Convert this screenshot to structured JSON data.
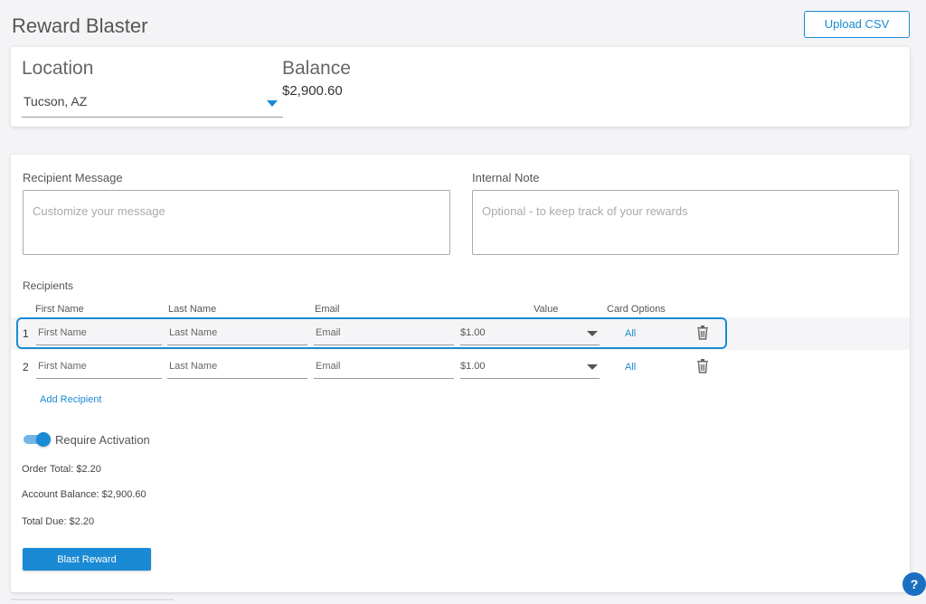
{
  "page": {
    "title": "Reward Blaster",
    "upload_label": "Upload CSV"
  },
  "location": {
    "label": "Location",
    "value": "Tucson, AZ"
  },
  "balance": {
    "label": "Balance",
    "value": "$2,900.60"
  },
  "recipient_message": {
    "label": "Recipient Message",
    "placeholder": "Customize your message"
  },
  "internal_note": {
    "label": "Internal Note",
    "placeholder": "Optional - to keep track of your rewards"
  },
  "recipients": {
    "title": "Recipients",
    "columns": [
      "First Name",
      "Last Name",
      "Email",
      "Value",
      "Card Options"
    ],
    "rows": [
      {
        "num": "1",
        "first_placeholder": "First Name",
        "last_placeholder": "Last Name",
        "email_placeholder": "Email",
        "value": "$1.00",
        "card_options": "All",
        "delete_icon": "trash-icon"
      },
      {
        "num": "2",
        "first_placeholder": "First Name",
        "last_placeholder": "Last Name",
        "email_placeholder": "Email",
        "value": "$1.00",
        "card_options": "All",
        "delete_icon": "trash-icon"
      }
    ],
    "add_label": "Add Recipient"
  },
  "activation": {
    "label": "Require Activation",
    "enabled": true
  },
  "summary": {
    "order_total": "Order Total: $2.20",
    "account_balance": "Account Balance: $2,900.60",
    "total_due": "Total Due: $2.20"
  },
  "blast_label": "Blast Reward",
  "help_label": "?",
  "colors": {
    "accent": "#1a8ad4",
    "help": "#1a6fc1",
    "background": "#f4f4f6"
  }
}
